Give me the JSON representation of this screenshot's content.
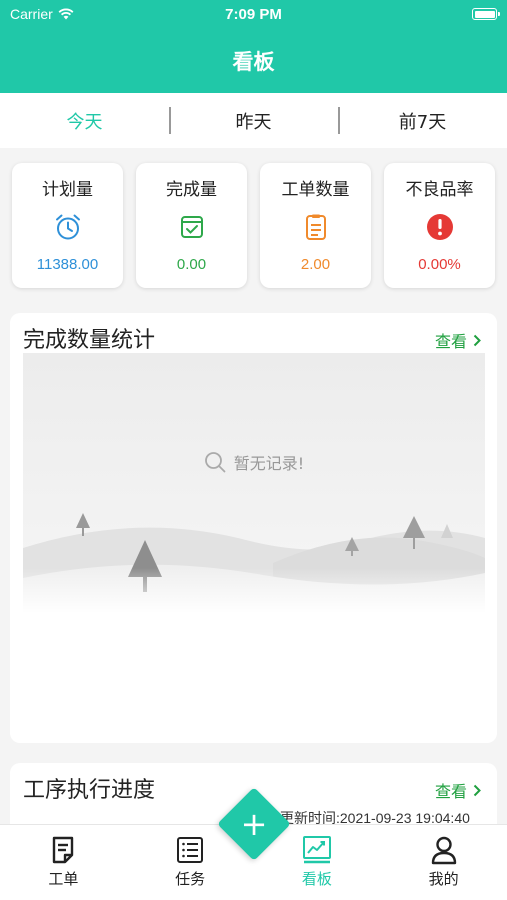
{
  "status_bar": {
    "carrier": "Carrier",
    "time": "7:09 PM"
  },
  "header": {
    "title": "看板"
  },
  "date_tabs": [
    {
      "label": "今天",
      "active": true
    },
    {
      "label": "昨天",
      "active": false
    },
    {
      "label": "前7天",
      "active": false
    }
  ],
  "stats": [
    {
      "label": "计划量",
      "value": "11388.00",
      "icon": "alarm-clock-icon",
      "color": "#2e90d8"
    },
    {
      "label": "完成量",
      "value": "0.00",
      "icon": "check-calendar-icon",
      "color": "#2ea84a"
    },
    {
      "label": "工单数量",
      "value": "2.00",
      "icon": "document-icon",
      "color": "#f08a2c"
    },
    {
      "label": "不良品率",
      "value": "0.00%",
      "icon": "alert-icon",
      "color": "#e53935"
    }
  ],
  "completion_card": {
    "title": "完成数量统计",
    "view_label": "查看",
    "empty_text": "暂无记录!"
  },
  "process_card": {
    "title": "工序执行进度",
    "view_label": "查看",
    "update_time": "更新时间:2021-09-23 19:04:40"
  },
  "tabbar": [
    {
      "label": "工单",
      "icon": "work-order-icon",
      "active": false
    },
    {
      "label": "任务",
      "icon": "task-list-icon",
      "active": false
    },
    {
      "label": "看板",
      "icon": "dashboard-chart-icon",
      "active": true
    },
    {
      "label": "我的",
      "icon": "user-icon",
      "active": false
    }
  ],
  "colors": {
    "primary": "#20c8a8",
    "link": "#20a040"
  }
}
